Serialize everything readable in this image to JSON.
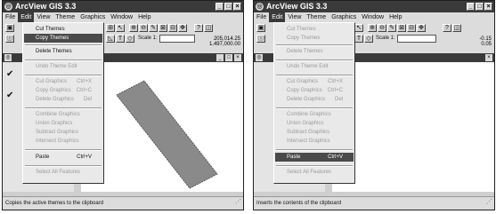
{
  "app_title": "ArcView GIS 3.3",
  "window_buttons": [
    "_",
    "□",
    "×"
  ],
  "menubar": [
    "File",
    "Edit",
    "View",
    "Theme",
    "Graphics",
    "Window",
    "Help"
  ],
  "scale_label": "Scale 1:",
  "left": {
    "coords": [
      "205,014.25",
      "1,497,000.00"
    ],
    "menu": [
      {
        "label": "Cut Themes",
        "shortcut": "",
        "state": "enabled"
      },
      {
        "label": "Copy Themes",
        "shortcut": "",
        "state": "highlighted"
      },
      {
        "label": "Delete Themes",
        "shortcut": "",
        "state": "enabled"
      },
      {
        "label": "Undo Theme Edit",
        "shortcut": "",
        "state": "disabled"
      },
      {
        "label": "Cut Graphics",
        "shortcut": "Ctrl+X",
        "state": "disabled"
      },
      {
        "label": "Copy Graphics",
        "shortcut": "Ctrl+C",
        "state": "disabled"
      },
      {
        "label": "Delete Graphics",
        "shortcut": "Del",
        "state": "disabled"
      },
      {
        "label": "Combine Graphics",
        "shortcut": "",
        "state": "disabled"
      },
      {
        "label": "Union Graphics",
        "shortcut": "",
        "state": "disabled"
      },
      {
        "label": "Subtract Graphics",
        "shortcut": "",
        "state": "disabled"
      },
      {
        "label": "Intersect Graphics",
        "shortcut": "",
        "state": "disabled"
      },
      {
        "label": "Paste",
        "shortcut": "Ctrl+V",
        "state": "enabled"
      },
      {
        "label": "Select All Features",
        "shortcut": "",
        "state": "disabled"
      }
    ],
    "status": "Copies the active themes to the clipboard"
  },
  "right": {
    "coords": [
      "-0.15",
      "0.05"
    ],
    "menu": [
      {
        "label": "Cut Themes",
        "shortcut": "",
        "state": "disabled"
      },
      {
        "label": "Copy Themes",
        "shortcut": "",
        "state": "disabled"
      },
      {
        "label": "Delete Themes",
        "shortcut": "",
        "state": "disabled"
      },
      {
        "label": "Undo Theme Edit",
        "shortcut": "",
        "state": "disabled"
      },
      {
        "label": "Cut Graphics",
        "shortcut": "Ctrl+X",
        "state": "disabled"
      },
      {
        "label": "Copy Graphics",
        "shortcut": "Ctrl+C",
        "state": "disabled"
      },
      {
        "label": "Delete Graphics",
        "shortcut": "Del",
        "state": "disabled"
      },
      {
        "label": "Combine Graphics",
        "shortcut": "",
        "state": "disabled"
      },
      {
        "label": "Union Graphics",
        "shortcut": "",
        "state": "disabled"
      },
      {
        "label": "Subtract Graphics",
        "shortcut": "",
        "state": "disabled"
      },
      {
        "label": "Intersect Graphics",
        "shortcut": "",
        "state": "disabled"
      },
      {
        "label": "Paste",
        "shortcut": "Ctrl+V",
        "state": "highlighted"
      },
      {
        "label": "Select All Features",
        "shortcut": "",
        "state": "disabled"
      }
    ],
    "status": "Inserts the contents of the clipboard"
  }
}
